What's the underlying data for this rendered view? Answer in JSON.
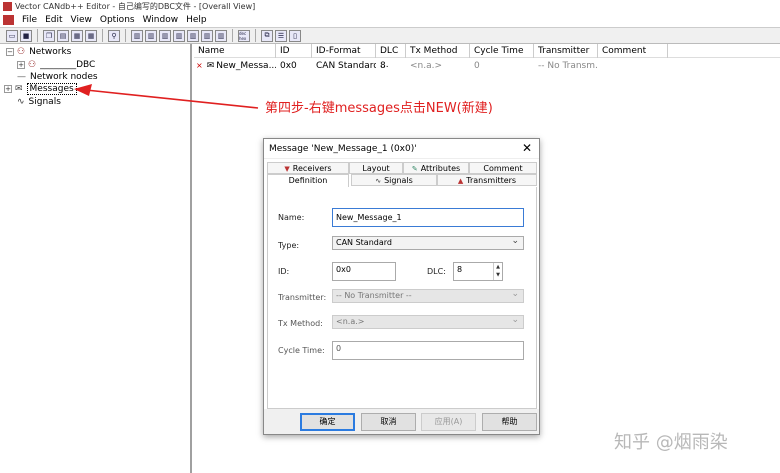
{
  "app": {
    "title": "Vector CANdb++ Editor - 自己编写的DBC文件 - [Overall View]",
    "menus": [
      "File",
      "Edit",
      "View",
      "Options",
      "Window",
      "Help"
    ]
  },
  "toolbar": {
    "buttons": [
      "open-icon",
      "save-icon",
      "copy-icon",
      "paste-icon",
      "grey-icon",
      "grey-icon",
      "find-icon",
      "view-icon",
      "view-icon",
      "view-icon",
      "view-icon",
      "view-icon",
      "view-icon",
      "view-icon",
      "hex-icon",
      "tile-icon",
      "tile-icon",
      "tile-icon"
    ],
    "hex_label": "dec hex"
  },
  "tree": {
    "networks": "Networks",
    "dbc": "________DBC",
    "network_nodes": "Network nodes",
    "messages": "Messages",
    "signals": "Signals"
  },
  "grid": {
    "columns": [
      "Name",
      "ID",
      "ID-Format",
      "DLC ...",
      "Tx Method",
      "Cycle Time",
      "Transmitter",
      "Comment"
    ],
    "rows": [
      {
        "name": "New_Messa...",
        "id": "0x0",
        "id_format": "CAN Standard",
        "dlc": "8",
        "tx_method": "<n.a.>",
        "cycle_time": "0",
        "transmitter": "-- No Transm...",
        "comment": ""
      }
    ]
  },
  "annotation": {
    "text": "第四步-右键messages点击NEW(新建)",
    "color": "#e02020"
  },
  "dialog": {
    "title": "Message 'New_Message_1 (0x0)'",
    "close": "✕",
    "tabs_row1": [
      "Receivers",
      "Layout",
      "Attributes",
      "Comment"
    ],
    "tabs_row2": [
      "Definition",
      "Signals",
      "Transmitters"
    ],
    "labels": {
      "name": "Name:",
      "type": "Type:",
      "id": "ID:",
      "dlc": "DLC:",
      "transmitter": "Transmitter:",
      "tx_method": "Tx Method:",
      "cycle_time": "Cycle Time:"
    },
    "values": {
      "name": "New_Message_1",
      "type": "CAN Standard",
      "id": "0x0",
      "dlc": "8",
      "transmitter": "-- No Transmitter --",
      "tx_method": "<n.a.>",
      "cycle_time": "0"
    },
    "buttons": {
      "ok": "确定",
      "cancel": "取消",
      "apply": "应用(A)",
      "help": "帮助"
    }
  },
  "watermark": "知乎 @烟雨染"
}
